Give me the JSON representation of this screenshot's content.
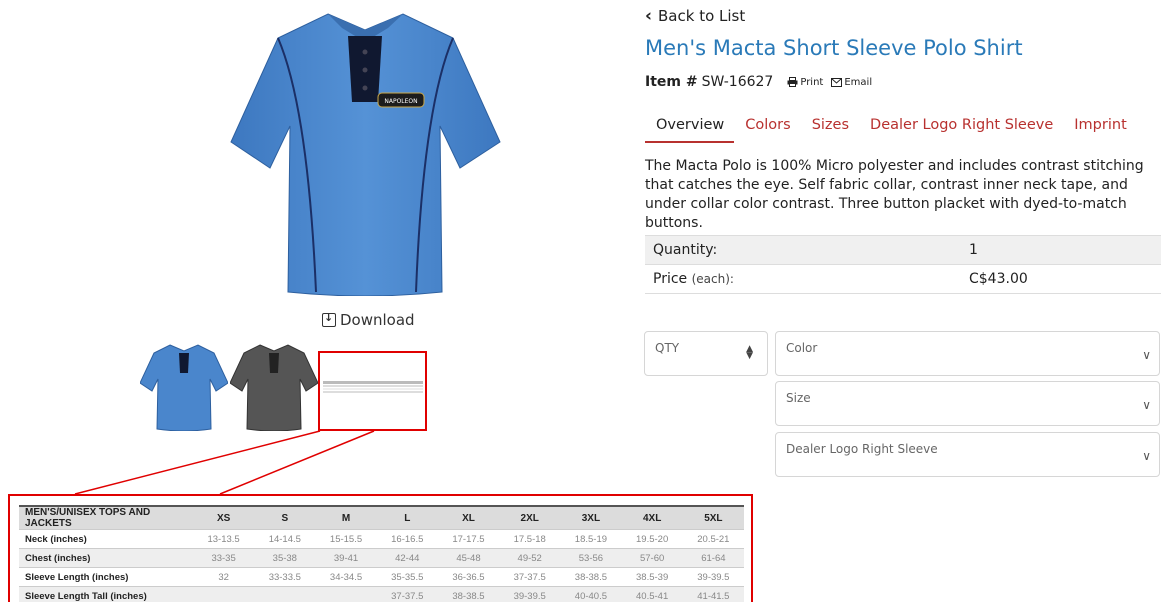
{
  "nav": {
    "back_label": "Back to List"
  },
  "product": {
    "title": "Men's Macta Short Sleeve Polo Shirt",
    "item_label": "Item #",
    "item_number": "SW-16627",
    "print_label": "Print",
    "email_label": "Email",
    "description": "The Macta Polo is 100% Micro polyester and includes contrast stitching that catches the eye. Self fabric collar, contrast inner neck tape, and under collar color contrast. Three button placket with dyed-to-match buttons.",
    "logo_text": "NAPOLEON"
  },
  "tabs": [
    {
      "label": "Overview",
      "active": true
    },
    {
      "label": "Colors",
      "active": false
    },
    {
      "label": "Sizes",
      "active": false
    },
    {
      "label": "Dealer Logo Right Sleeve",
      "active": false
    },
    {
      "label": "Imprint",
      "active": false
    }
  ],
  "pricing": {
    "quantity_label": "Quantity:",
    "quantity_value": "1",
    "price_label": "Price",
    "price_suffix": "(each):",
    "price_value": "C$43.00"
  },
  "options": {
    "qty_placeholder": "QTY",
    "color_placeholder": "Color",
    "size_placeholder": "Size",
    "logo_placeholder": "Dealer Logo Right Sleeve"
  },
  "gallery": {
    "download_label": "Download"
  },
  "size_chart": {
    "headers": [
      "MEN'S/UNISEX TOPS AND JACKETS",
      "XS",
      "S",
      "M",
      "L",
      "XL",
      "2XL",
      "3XL",
      "4XL",
      "5XL"
    ],
    "rows": [
      [
        "Neck (inches)",
        "13-13.5",
        "14-14.5",
        "15-15.5",
        "16-16.5",
        "17-17.5",
        "17.5-18",
        "18.5-19",
        "19.5-20",
        "20.5-21"
      ],
      [
        "Chest (inches)",
        "33-35",
        "35-38",
        "39-41",
        "42-44",
        "45-48",
        "49-52",
        "53-56",
        "57-60",
        "61-64"
      ],
      [
        "Sleeve Length (inches)",
        "32",
        "33-33.5",
        "34-34.5",
        "35-35.5",
        "36-36.5",
        "37-37.5",
        "38-38.5",
        "38.5-39",
        "39-39.5"
      ],
      [
        "Sleeve Length Tall (inches)",
        "",
        "",
        "",
        "37-37.5",
        "38-38.5",
        "39-39.5",
        "40-40.5",
        "40.5-41",
        "41-41.5"
      ]
    ]
  },
  "colors": {
    "accent_blue": "#2a7ab8",
    "tab_red": "#b8312f",
    "shirt_blue": "#4a86cc",
    "shirt_grey": "#555555",
    "highlight_red": "#e00000"
  }
}
